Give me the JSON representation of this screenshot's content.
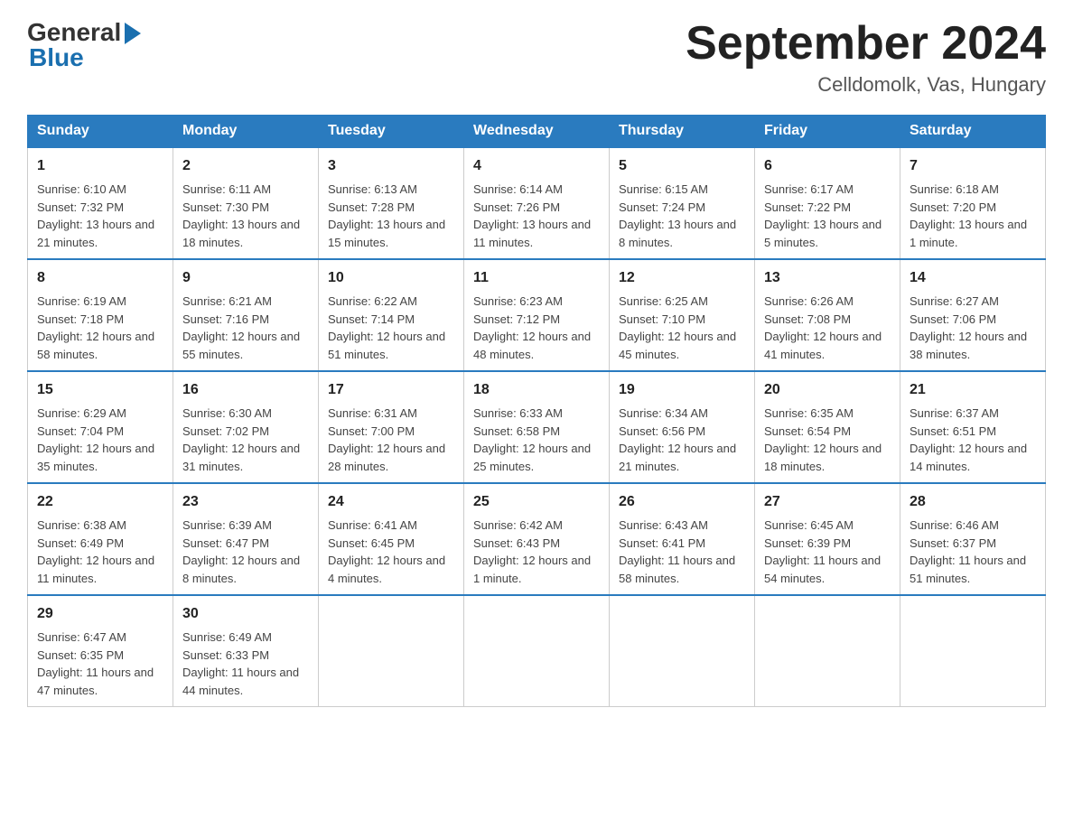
{
  "logo": {
    "general": "General",
    "blue": "Blue"
  },
  "header": {
    "title": "September 2024",
    "location": "Celldomolk, Vas, Hungary"
  },
  "days_of_week": [
    "Sunday",
    "Monday",
    "Tuesday",
    "Wednesday",
    "Thursday",
    "Friday",
    "Saturday"
  ],
  "weeks": [
    [
      {
        "day": "1",
        "sunrise": "6:10 AM",
        "sunset": "7:32 PM",
        "daylight": "13 hours and 21 minutes."
      },
      {
        "day": "2",
        "sunrise": "6:11 AM",
        "sunset": "7:30 PM",
        "daylight": "13 hours and 18 minutes."
      },
      {
        "day": "3",
        "sunrise": "6:13 AM",
        "sunset": "7:28 PM",
        "daylight": "13 hours and 15 minutes."
      },
      {
        "day": "4",
        "sunrise": "6:14 AM",
        "sunset": "7:26 PM",
        "daylight": "13 hours and 11 minutes."
      },
      {
        "day": "5",
        "sunrise": "6:15 AM",
        "sunset": "7:24 PM",
        "daylight": "13 hours and 8 minutes."
      },
      {
        "day": "6",
        "sunrise": "6:17 AM",
        "sunset": "7:22 PM",
        "daylight": "13 hours and 5 minutes."
      },
      {
        "day": "7",
        "sunrise": "6:18 AM",
        "sunset": "7:20 PM",
        "daylight": "13 hours and 1 minute."
      }
    ],
    [
      {
        "day": "8",
        "sunrise": "6:19 AM",
        "sunset": "7:18 PM",
        "daylight": "12 hours and 58 minutes."
      },
      {
        "day": "9",
        "sunrise": "6:21 AM",
        "sunset": "7:16 PM",
        "daylight": "12 hours and 55 minutes."
      },
      {
        "day": "10",
        "sunrise": "6:22 AM",
        "sunset": "7:14 PM",
        "daylight": "12 hours and 51 minutes."
      },
      {
        "day": "11",
        "sunrise": "6:23 AM",
        "sunset": "7:12 PM",
        "daylight": "12 hours and 48 minutes."
      },
      {
        "day": "12",
        "sunrise": "6:25 AM",
        "sunset": "7:10 PM",
        "daylight": "12 hours and 45 minutes."
      },
      {
        "day": "13",
        "sunrise": "6:26 AM",
        "sunset": "7:08 PM",
        "daylight": "12 hours and 41 minutes."
      },
      {
        "day": "14",
        "sunrise": "6:27 AM",
        "sunset": "7:06 PM",
        "daylight": "12 hours and 38 minutes."
      }
    ],
    [
      {
        "day": "15",
        "sunrise": "6:29 AM",
        "sunset": "7:04 PM",
        "daylight": "12 hours and 35 minutes."
      },
      {
        "day": "16",
        "sunrise": "6:30 AM",
        "sunset": "7:02 PM",
        "daylight": "12 hours and 31 minutes."
      },
      {
        "day": "17",
        "sunrise": "6:31 AM",
        "sunset": "7:00 PM",
        "daylight": "12 hours and 28 minutes."
      },
      {
        "day": "18",
        "sunrise": "6:33 AM",
        "sunset": "6:58 PM",
        "daylight": "12 hours and 25 minutes."
      },
      {
        "day": "19",
        "sunrise": "6:34 AM",
        "sunset": "6:56 PM",
        "daylight": "12 hours and 21 minutes."
      },
      {
        "day": "20",
        "sunrise": "6:35 AM",
        "sunset": "6:54 PM",
        "daylight": "12 hours and 18 minutes."
      },
      {
        "day": "21",
        "sunrise": "6:37 AM",
        "sunset": "6:51 PM",
        "daylight": "12 hours and 14 minutes."
      }
    ],
    [
      {
        "day": "22",
        "sunrise": "6:38 AM",
        "sunset": "6:49 PM",
        "daylight": "12 hours and 11 minutes."
      },
      {
        "day": "23",
        "sunrise": "6:39 AM",
        "sunset": "6:47 PM",
        "daylight": "12 hours and 8 minutes."
      },
      {
        "day": "24",
        "sunrise": "6:41 AM",
        "sunset": "6:45 PM",
        "daylight": "12 hours and 4 minutes."
      },
      {
        "day": "25",
        "sunrise": "6:42 AM",
        "sunset": "6:43 PM",
        "daylight": "12 hours and 1 minute."
      },
      {
        "day": "26",
        "sunrise": "6:43 AM",
        "sunset": "6:41 PM",
        "daylight": "11 hours and 58 minutes."
      },
      {
        "day": "27",
        "sunrise": "6:45 AM",
        "sunset": "6:39 PM",
        "daylight": "11 hours and 54 minutes."
      },
      {
        "day": "28",
        "sunrise": "6:46 AM",
        "sunset": "6:37 PM",
        "daylight": "11 hours and 51 minutes."
      }
    ],
    [
      {
        "day": "29",
        "sunrise": "6:47 AM",
        "sunset": "6:35 PM",
        "daylight": "11 hours and 47 minutes."
      },
      {
        "day": "30",
        "sunrise": "6:49 AM",
        "sunset": "6:33 PM",
        "daylight": "11 hours and 44 minutes."
      },
      null,
      null,
      null,
      null,
      null
    ]
  ]
}
